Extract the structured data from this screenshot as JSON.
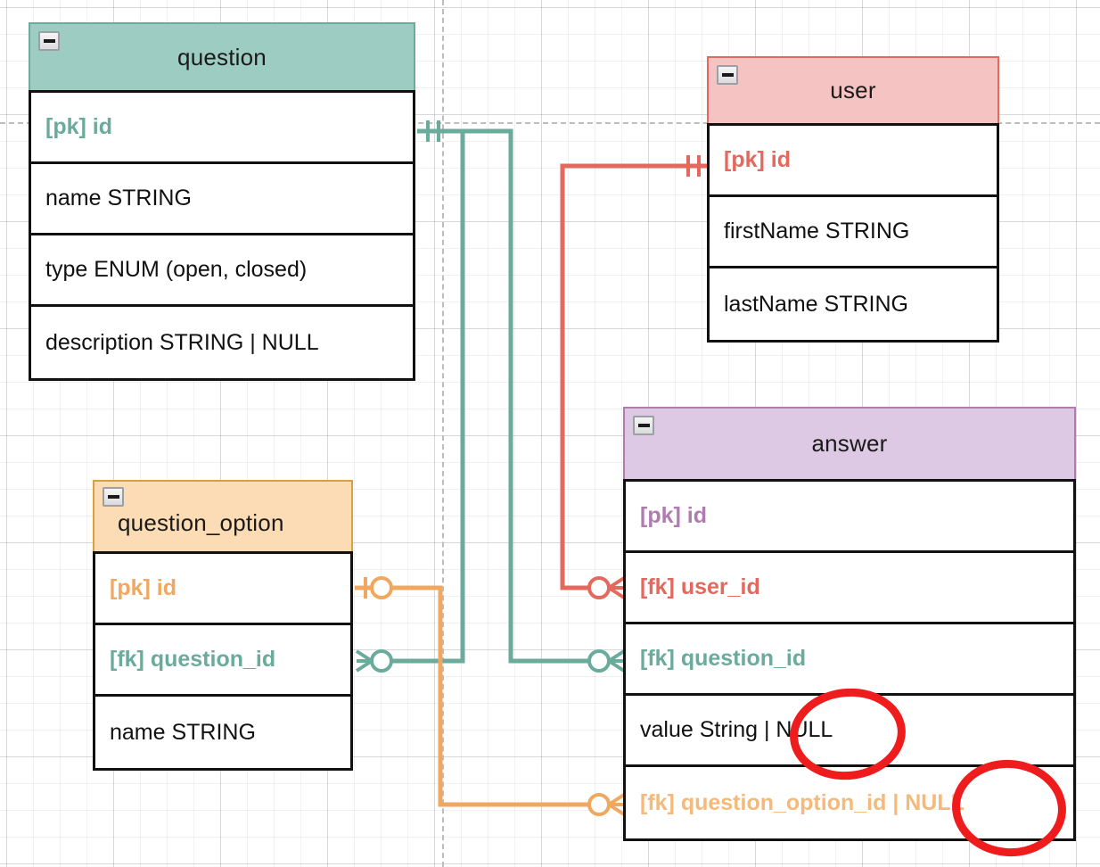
{
  "diagram": {
    "kind": "entity-relationship-diagram",
    "notation": "crows-foot",
    "background": "grid-canvas"
  },
  "colors": {
    "question": "#6aab9c",
    "question_header_fill": "#9dccc2",
    "user": "#e4685d",
    "user_header_fill": "#f5c3c2",
    "question_option": "#f0a860",
    "question_option_header_fill": "#fbdcb4",
    "answer": "#b07cb0",
    "answer_header_fill": "#ddc9e4",
    "annotation_red": "#ee1c1c",
    "row_border": "#111111",
    "text": "#111111"
  },
  "tables": [
    {
      "id": "question",
      "name": "question",
      "collapse_icon": "minus-icon",
      "columns": [
        {
          "label": "[pk] id",
          "style": "key",
          "color_key": "question"
        },
        {
          "label": "name STRING",
          "style": "plain"
        },
        {
          "label": "type ENUM (open, closed)",
          "style": "plain"
        },
        {
          "label": "description STRING | NULL",
          "style": "plain"
        }
      ]
    },
    {
      "id": "user",
      "name": "user",
      "collapse_icon": "minus-icon",
      "columns": [
        {
          "label": "[pk] id",
          "style": "key",
          "color_key": "user"
        },
        {
          "label": "firstName STRING",
          "style": "plain"
        },
        {
          "label": "lastName STRING",
          "style": "plain"
        }
      ]
    },
    {
      "id": "question_option",
      "name": "question_option",
      "collapse_icon": "minus-icon",
      "columns": [
        {
          "label": "[pk] id",
          "style": "key",
          "color_key": "question_option"
        },
        {
          "label": "[fk] question_id",
          "style": "key",
          "color_key": "question"
        },
        {
          "label": "name STRING",
          "style": "plain"
        }
      ]
    },
    {
      "id": "answer",
      "name": "answer",
      "collapse_icon": "minus-icon",
      "columns": [
        {
          "label": "[pk] id",
          "style": "key",
          "color_key": "answer"
        },
        {
          "label": "[fk] user_id",
          "style": "key",
          "color_key": "user"
        },
        {
          "label": "[fk] question_id",
          "style": "key",
          "color_key": "question"
        },
        {
          "label": "value String | NULL",
          "style": "plain"
        },
        {
          "label": "[fk] question_option_id | NULL",
          "style": "key",
          "color_key": "question_option"
        }
      ]
    }
  ],
  "relationships": [
    {
      "id": "question-to-question_option",
      "from": "question.[pk] id",
      "to": "question_option.[fk] question_id",
      "from_cardinality": "one-and-only-one",
      "to_cardinality": "zero-or-many",
      "color_key": "question"
    },
    {
      "id": "question-to-answer",
      "from": "question.[pk] id",
      "to": "answer.[fk] question_id",
      "from_cardinality": "one-and-only-one",
      "to_cardinality": "zero-or-many",
      "color_key": "question"
    },
    {
      "id": "user-to-answer",
      "from": "user.[pk] id",
      "to": "answer.[fk] user_id",
      "from_cardinality": "one-and-only-one",
      "to_cardinality": "zero-or-many",
      "color_key": "user"
    },
    {
      "id": "question_option-to-answer",
      "from": "question_option.[pk] id",
      "to": "answer.[fk] question_option_id",
      "from_cardinality": "one-and-only-one",
      "to_cardinality": "zero-or-many",
      "color_key": "question_option"
    }
  ],
  "annotations": [
    {
      "id": "annotation-value-null",
      "shape": "hand-drawn-circle",
      "target_text": "| NULL",
      "target_row": "answer.value String | NULL",
      "color_key": "annotation_red"
    },
    {
      "id": "annotation-question-option-id-null",
      "shape": "hand-drawn-circle",
      "target_text": "| NULL",
      "target_row": "answer.[fk] question_option_id | NULL",
      "color_key": "annotation_red"
    }
  ]
}
